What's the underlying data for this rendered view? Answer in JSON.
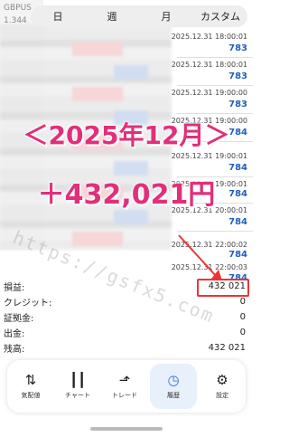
{
  "symbol_header": {
    "symbol": "GBPUS",
    "price": "1.344"
  },
  "tabs": [
    {
      "label": "日"
    },
    {
      "label": "週"
    },
    {
      "label": "月"
    },
    {
      "label": "カスタム"
    }
  ],
  "trades": [
    {
      "time": "2025.12.31 18:00:01",
      "value": "783"
    },
    {
      "time": "2025.12.31 18:00:01",
      "value": "783"
    },
    {
      "time": "2025.12.31 19:00:00",
      "value": "783"
    },
    {
      "time": "2025.12.31 19:00:00",
      "value": "784"
    },
    {
      "time": "2025.12.31 19:00:01",
      "value": "784"
    },
    {
      "time": "2025.12.31 19:00:01",
      "value": "784"
    },
    {
      "time": "2025.12.31 20:00:01",
      "value": "784"
    },
    {
      "time": "2025.12.31 22:00:02",
      "value": "784"
    },
    {
      "time": "2025.12.31 22:00:03",
      "value": "784"
    }
  ],
  "overlay": {
    "headline": "＜2025年12月＞",
    "profit": "＋432,021円",
    "watermark": "https://gsfx5.com"
  },
  "summary": [
    {
      "label": "損益:",
      "value": "432 021"
    },
    {
      "label": "クレジット:",
      "value": "0"
    },
    {
      "label": "証拠金:",
      "value": "0"
    },
    {
      "label": "出金:",
      "value": "0"
    },
    {
      "label": "残高:",
      "value": "432 021"
    }
  ],
  "nav": [
    {
      "label": "気配値",
      "icon": "quotes-icon"
    },
    {
      "label": "チャート",
      "icon": "chart-icon"
    },
    {
      "label": "トレード",
      "icon": "trade-icon"
    },
    {
      "label": "履歴",
      "icon": "history-icon"
    },
    {
      "label": "設定",
      "icon": "settings-icon"
    }
  ],
  "colors": {
    "accent": "#e0307a",
    "value_blue": "#1f5fbf",
    "highlight_red": "#e33333",
    "active_nav": "#2b6fd6"
  }
}
